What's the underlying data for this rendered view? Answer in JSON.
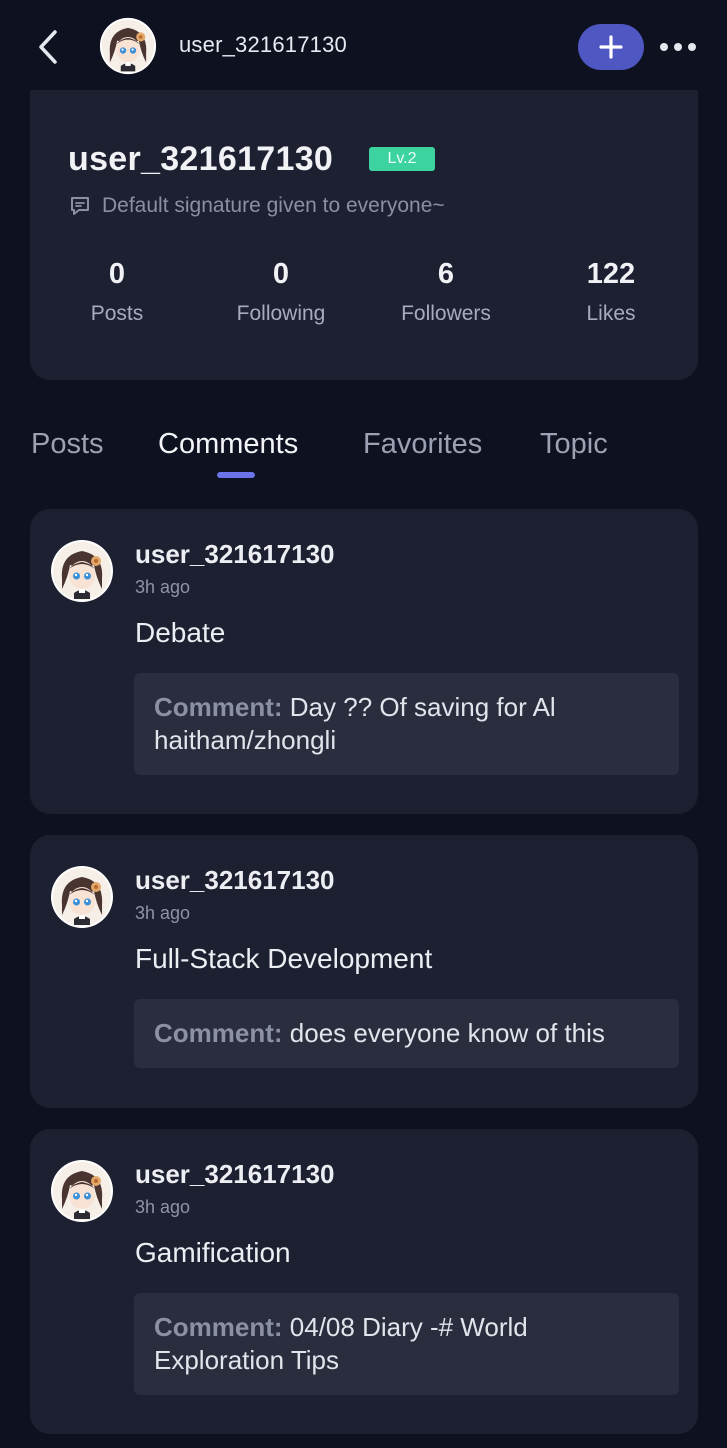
{
  "header": {
    "username": "user_321617130",
    "back_icon": "back-chevron-icon",
    "plus_icon": "plus-icon",
    "more_icon": "more-dots-icon",
    "accent": "#4f57c2"
  },
  "profile": {
    "name": "user_321617130",
    "level": "Lv.2",
    "level_color": "#3dd3a0",
    "signature": "Default signature given to everyone~",
    "stats": [
      {
        "value": "0",
        "label": "Posts"
      },
      {
        "value": "0",
        "label": "Following"
      },
      {
        "value": "6",
        "label": "Followers"
      },
      {
        "value": "122",
        "label": "Likes"
      }
    ]
  },
  "tabs": [
    {
      "label": "Posts",
      "active": false
    },
    {
      "label": "Comments",
      "active": true
    },
    {
      "label": "Favorites",
      "active": false
    },
    {
      "label": "Topic",
      "active": false
    }
  ],
  "comment_prefix": "Comment:",
  "comments": [
    {
      "user": "user_321617130",
      "time": "3h ago",
      "title": "Debate",
      "text": "Day ?? Of saving for Al haitham/zhongli"
    },
    {
      "user": "user_321617130",
      "time": "3h ago",
      "title": "Full-Stack Development",
      "text": "does everyone know of this"
    },
    {
      "user": "user_321617130",
      "time": "3h ago",
      "title": "Gamification",
      "text": "04/08 Diary -# World Exploration Tips"
    }
  ]
}
